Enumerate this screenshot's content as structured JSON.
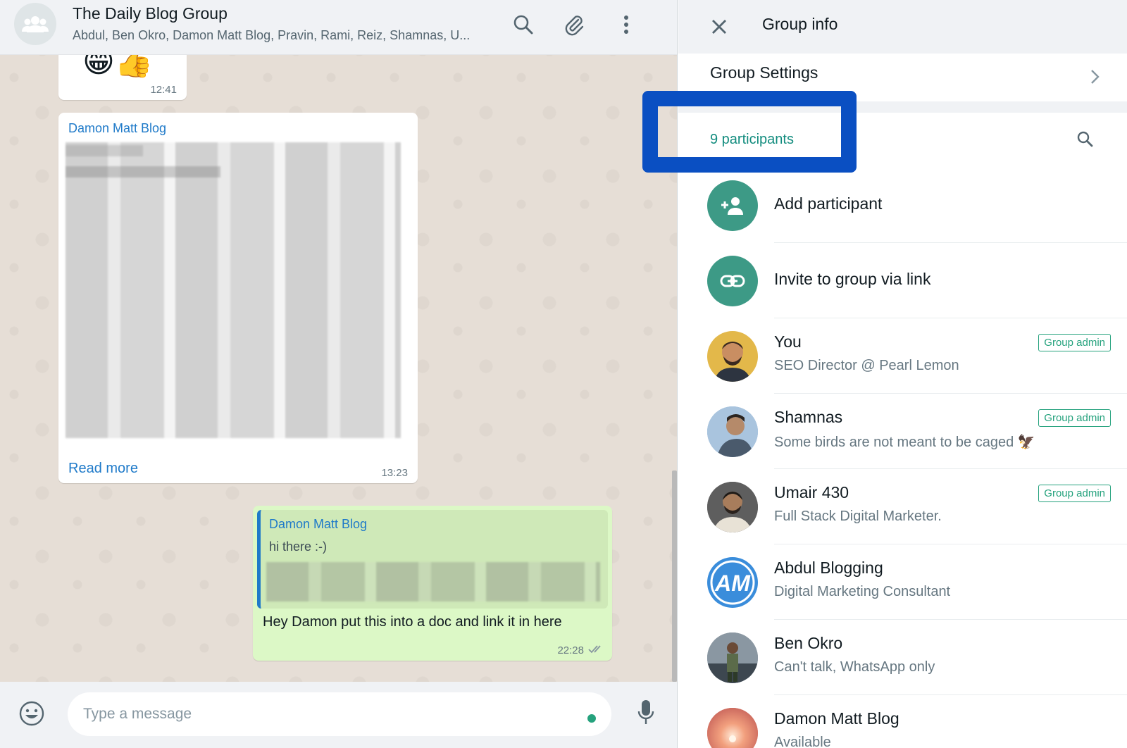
{
  "chat": {
    "title": "The Daily Blog Group",
    "members": "Abdul, Ben Okro, Damon Matt Blog, Pravin, Rami, Reiz, Shamnas, U...",
    "header_icons": [
      "search-icon",
      "attachment-icon",
      "menu-icon"
    ],
    "messages": [
      {
        "type": "emoji",
        "content": "😁👍",
        "time": "12:41"
      },
      {
        "type": "incoming",
        "sender": "Damon Matt Blog",
        "read_more": "Read more",
        "time": "13:23"
      },
      {
        "type": "outgoing",
        "quoted_sender": "Damon Matt Blog",
        "quoted_text": "hi there :-)",
        "text": "Hey Damon put this into a doc and link it in here",
        "time": "22:28",
        "status_icon": "double-check-icon"
      }
    ],
    "composer": {
      "placeholder": "Type a message",
      "emoji_icon": "smiley-icon",
      "mic_icon": "microphone-icon"
    }
  },
  "info": {
    "title": "Group info",
    "settings_label": "Group Settings",
    "participants_count": "9 participants",
    "actions": [
      {
        "label": "Add participant",
        "icon": "add-person-icon"
      },
      {
        "label": "Invite to group via link",
        "icon": "link-icon"
      }
    ],
    "participants": [
      {
        "name": "You",
        "status": "SEO Director @ Pearl Lemon",
        "badge": "Group admin"
      },
      {
        "name": "Shamnas",
        "status": "Some birds are not meant to be caged 🦅",
        "badge": "Group admin"
      },
      {
        "name": "Umair 430",
        "status": "Full Stack Digital Marketer.",
        "badge": "Group admin"
      },
      {
        "name": "Abdul Blogging",
        "status": "Digital Marketing Consultant",
        "badge": ""
      },
      {
        "name": "Ben Okro",
        "status": "Can't talk, WhatsApp only",
        "badge": ""
      },
      {
        "name": "Damon Matt Blog",
        "status": "Available",
        "badge": ""
      }
    ],
    "avatar_logo_text": "AM"
  },
  "colors": {
    "accent": "#25a27d",
    "link": "#1f7ac9",
    "highlight": "#0a4fc2",
    "outgoing_bubble": "#dcf8c6"
  }
}
